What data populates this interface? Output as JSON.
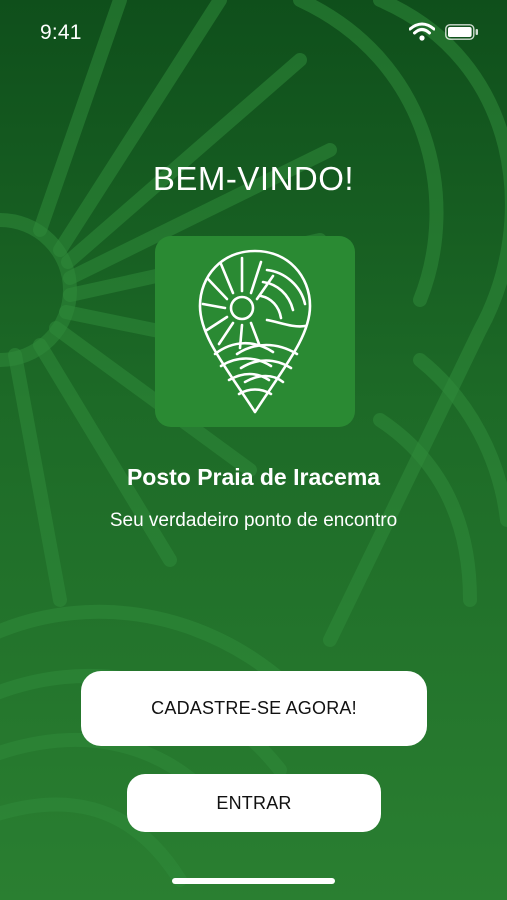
{
  "status_bar": {
    "time": "9:41",
    "wifi_icon": "wifi-icon",
    "battery_icon": "battery-icon"
  },
  "welcome": {
    "heading": "BEM-VINDO!"
  },
  "brand": {
    "logo_icon": "map-pin-sun-waves-icon",
    "name": "Posto Praia de Iracema",
    "tagline": "Seu verdadeiro ponto de encontro"
  },
  "actions": {
    "register_label": "CADASTRE-SE AGORA!",
    "login_label": "ENTRAR"
  },
  "colors": {
    "background_top": "#0f4f1b",
    "background_bottom": "#2a7f31",
    "logo_tile": "#2a8a33",
    "button": "#ffffff",
    "button_text": "#111111"
  }
}
